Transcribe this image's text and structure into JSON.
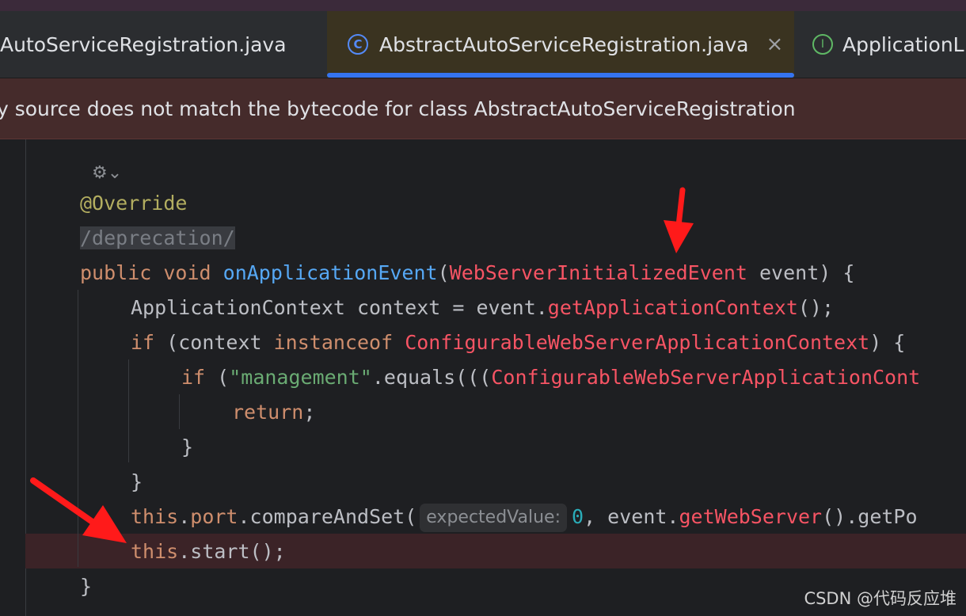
{
  "tabs": [
    {
      "label": "AutoServiceRegistration.java",
      "active": false,
      "icon": "class-icon"
    },
    {
      "label": "AbstractAutoServiceRegistration.java",
      "active": true,
      "icon": "class-icon"
    },
    {
      "label": "ApplicationL",
      "active": false,
      "icon": "interface-icon"
    }
  ],
  "close_glyph": "×",
  "banner": {
    "text": "y source does not match the bytecode for class AbstractAutoServiceRegistration"
  },
  "ai_glyph": "⚙⌄",
  "code": {
    "l1": {
      "ann": "@Override"
    },
    "l2": {
      "text": "/deprecation/"
    },
    "l3": {
      "kw1": "public",
      "kw2": "void",
      "method": "onApplicationEvent",
      "paren": "(",
      "type": "WebServerInitializedEvent",
      "rest": " event) {"
    },
    "l4": {
      "a": "ApplicationContext context = event.",
      "call": "getApplicationContext",
      "b": "();"
    },
    "l5": {
      "kw": "if",
      "a": " (context ",
      "kw2": "instanceof",
      "type": "ConfigurableWebServerApplicationContext",
      "b": ") {"
    },
    "l6": {
      "kw": "if",
      "a": " (",
      "str": "\"management\"",
      "b": ".equals(((",
      "type": "ConfigurableWebServerApplicationCont"
    },
    "l7": {
      "kw": "return",
      "b": ";"
    },
    "l8": {
      "text": "}"
    },
    "l9": {
      "text": "}"
    },
    "l10": {
      "kw": "this",
      "a": ".",
      "field": "port",
      "b": ".compareAndSet(",
      "hint": "expectedValue:",
      "num": "0",
      "c": ", event.",
      "call": "getWebServer",
      "d": "().getPo"
    },
    "l11": {
      "kw": "this",
      "a": ".start();"
    },
    "l12": {
      "text": "}"
    }
  },
  "watermark": "CSDN @代码反应堆",
  "colors": {
    "accent": "#3574f0",
    "error": "#f75464",
    "keyword": "#cf8e6d",
    "arrow": "#ff1a1a"
  }
}
